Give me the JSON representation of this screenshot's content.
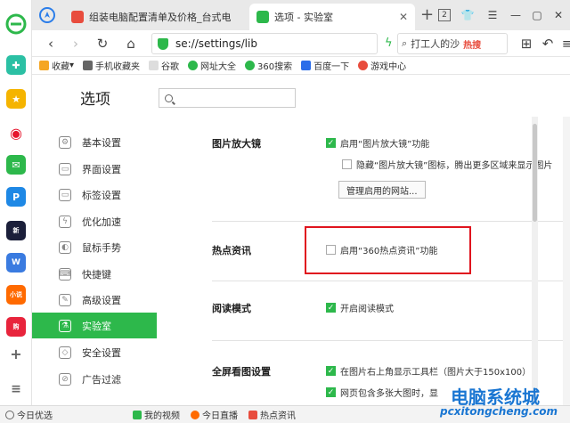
{
  "browser": {
    "tabs": [
      {
        "title": "组装电脑配置清单及价格_台式电",
        "active": false
      },
      {
        "title": "选项 - 实验室",
        "active": true
      }
    ],
    "tab_counter": "2",
    "address": "se://settings/lib",
    "search_placeholder": "打工人的沙",
    "search_hot": "热搜"
  },
  "bookmarks": [
    {
      "label": "收藏",
      "color": "#f5a623"
    },
    {
      "label": "手机收藏夹",
      "color": "#666666"
    },
    {
      "label": "谷歌",
      "color": "#999999"
    },
    {
      "label": "网址大全",
      "color": "#2db84b"
    },
    {
      "label": "360搜索",
      "color": "#2db84b"
    },
    {
      "label": "百度一下",
      "color": "#2b6de9"
    },
    {
      "label": "游戏中心",
      "color": "#e84c3d"
    }
  ],
  "settings": {
    "title": "选项",
    "sidebar": [
      {
        "label": "基本设置",
        "icon": "gear-icon",
        "glyph": "⚙"
      },
      {
        "label": "界面设置",
        "icon": "window-icon",
        "glyph": "▭"
      },
      {
        "label": "标签设置",
        "icon": "tab-icon",
        "glyph": "▭"
      },
      {
        "label": "优化加速",
        "icon": "lightning-icon",
        "glyph": "ϟ"
      },
      {
        "label": "鼠标手势",
        "icon": "mouse-icon",
        "glyph": "◐"
      },
      {
        "label": "快捷键",
        "icon": "keyboard-icon",
        "glyph": "⌨"
      },
      {
        "label": "高级设置",
        "icon": "wrench-icon",
        "glyph": "✎"
      },
      {
        "label": "实验室",
        "icon": "flask-icon",
        "glyph": "⚗",
        "active": true
      },
      {
        "label": "安全设置",
        "icon": "shield-icon",
        "glyph": "◇"
      },
      {
        "label": "广告过滤",
        "icon": "block-icon",
        "glyph": "⊘"
      }
    ],
    "sections": {
      "zoom": {
        "title": "图片放大镜",
        "opt1": "启用“图片放大镜”功能",
        "opt2": "隐藏“图片放大镜”图标，腾出更多区域来显示图片",
        "button": "管理启用的网站..."
      },
      "hotnews": {
        "title": "热点资讯",
        "opt1": "启用“360热点资讯”功能"
      },
      "reader": {
        "title": "阅读模式",
        "opt1": "开启阅读模式"
      },
      "fullscreen": {
        "title": "全屏看图设置",
        "opt1": "在图片右上角显示工具栏（图片大于150x100）",
        "opt2": "网页包含多张大图时，显"
      }
    }
  },
  "statusbar": {
    "items": [
      "今日优选",
      "我的视频",
      "今日直播",
      "热点资讯"
    ]
  },
  "watermark": {
    "main": "电脑系统城",
    "sub": "pcxitongcheng.com"
  },
  "colors": {
    "accent": "#2db84b",
    "highlight": "#e0141e",
    "brand": "#1a76d2"
  }
}
